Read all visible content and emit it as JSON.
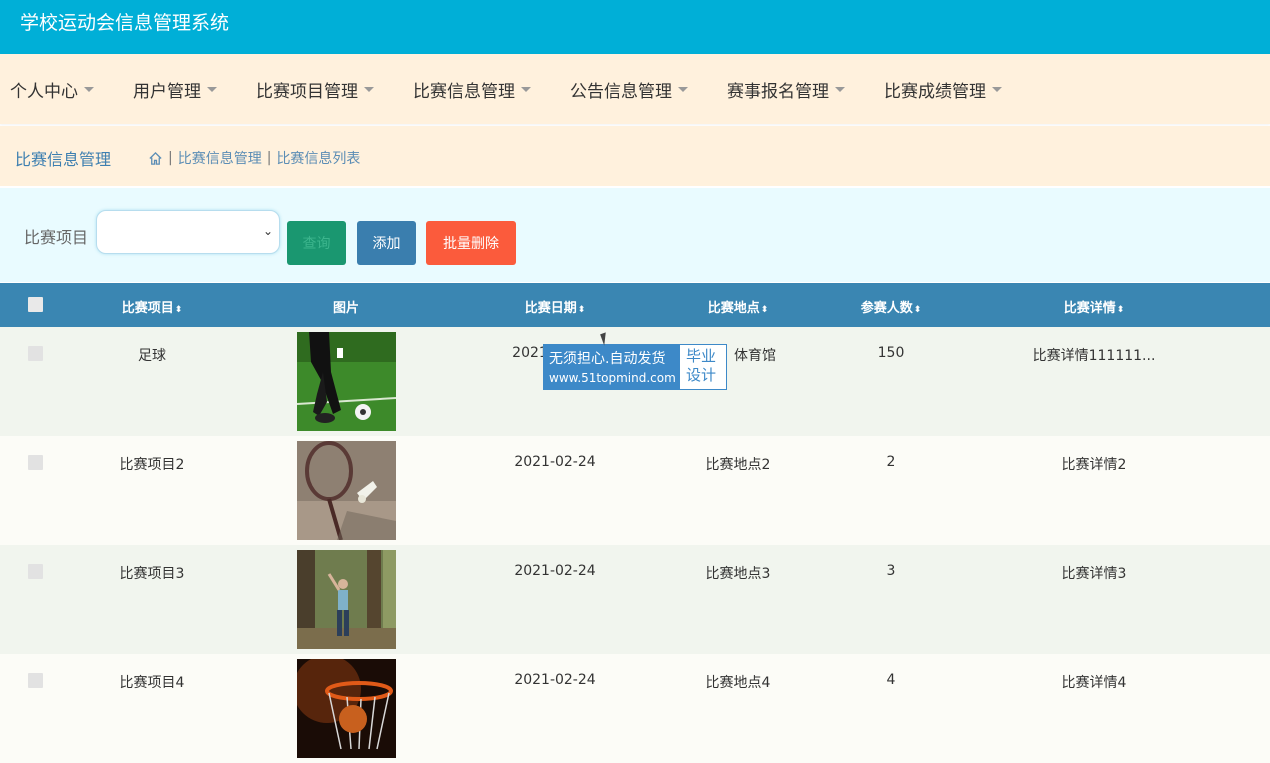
{
  "app": {
    "title": "学校运动会信息管理系统"
  },
  "menu": [
    {
      "label": "个人中心"
    },
    {
      "label": "用户管理"
    },
    {
      "label": "比赛项目管理"
    },
    {
      "label": "比赛信息管理"
    },
    {
      "label": "公告信息管理"
    },
    {
      "label": "赛事报名管理"
    },
    {
      "label": "比赛成绩管理"
    }
  ],
  "breadcrumb": {
    "title": "比赛信息管理",
    "items": [
      "比赛信息管理",
      "比赛信息列表"
    ]
  },
  "search": {
    "label": "比赛项目",
    "select_value": "",
    "search_button": "查询",
    "add_button": "添加",
    "batch_delete_button": "批量删除"
  },
  "table": {
    "headers": [
      "比赛项目",
      "图片",
      "比赛日期",
      "比赛地点",
      "参赛人数",
      "比赛详情"
    ],
    "rows": [
      {
        "project": "足球",
        "image": "soccer",
        "date": "2021",
        "location": "体育馆",
        "count": "150",
        "detail": "比赛详情111111..."
      },
      {
        "project": "比赛项目2",
        "image": "badminton",
        "date": "2021-02-24",
        "location": "比赛地点2",
        "count": "2",
        "detail": "比赛详情2"
      },
      {
        "project": "比赛项目3",
        "image": "yoga",
        "date": "2021-02-24",
        "location": "比赛地点3",
        "count": "3",
        "detail": "比赛详情3"
      },
      {
        "project": "比赛项目4",
        "image": "basketball",
        "date": "2021-02-24",
        "location": "比赛地点4",
        "count": "4",
        "detail": "比赛详情4"
      }
    ]
  },
  "watermark": {
    "line1": "无须担心.自动发货",
    "line2": "www.51topmind.com",
    "right1": "毕业",
    "right2": "设计"
  }
}
